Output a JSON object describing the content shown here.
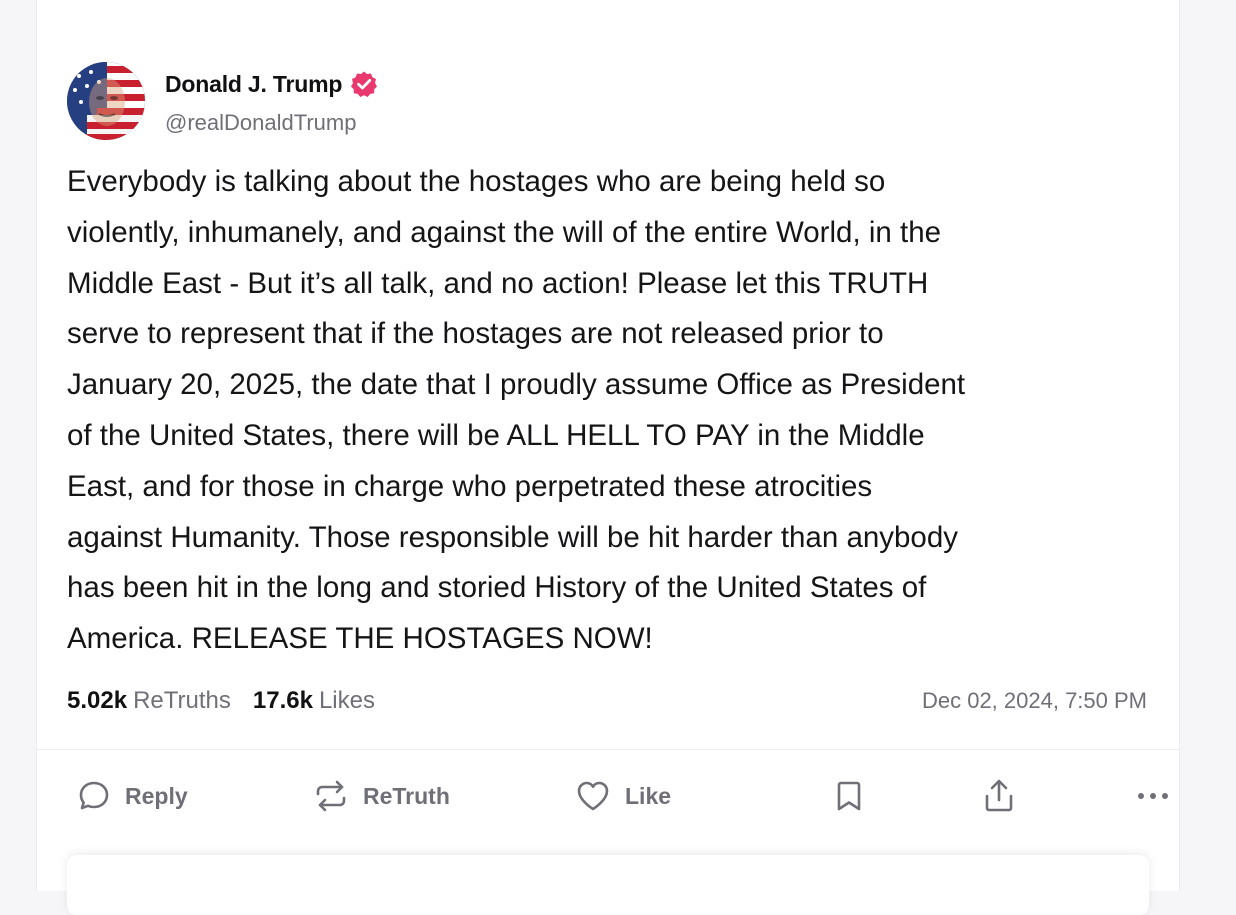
{
  "author": {
    "display_name": "Donald J. Trump",
    "handle": "@realDonaldTrump",
    "avatar_icon": "flag-portrait-avatar",
    "verified_icon": "verified-badge-icon",
    "verified_color": "#e8386d"
  },
  "post": {
    "text": "Everybody is talking about the hostages who are being held so\nviolently, inhumanely, and against the will of the entire World, in the\nMiddle East - But it’s all talk, and no action! Please let this TRUTH\nserve to represent that if the hostages are not released prior to\nJanuary 20, 2025, the date that I proudly assume Office as President\nof the United States, there will be ALL HELL TO PAY in the Middle\nEast, and for those in charge who perpetrated these atrocities\nagainst Humanity. Those responsible will be hit harder than anybody\nhas been hit in the long and storied History of the United States of\nAmerica. RELEASE THE HOSTAGES NOW!",
    "retruths_count": "5.02k",
    "retruths_label": "ReTruths",
    "likes_count": "17.6k",
    "likes_label": "Likes",
    "timestamp": "Dec 02, 2024, 7:50 PM"
  },
  "actions": {
    "reply_label": "Reply",
    "retruth_label": "ReTruth",
    "like_label": "Like",
    "icons": [
      "reply-icon",
      "retruth-icon",
      "like-icon",
      "bookmark-icon",
      "share-icon",
      "more-icon"
    ],
    "icon_color": "#6f6f78"
  }
}
